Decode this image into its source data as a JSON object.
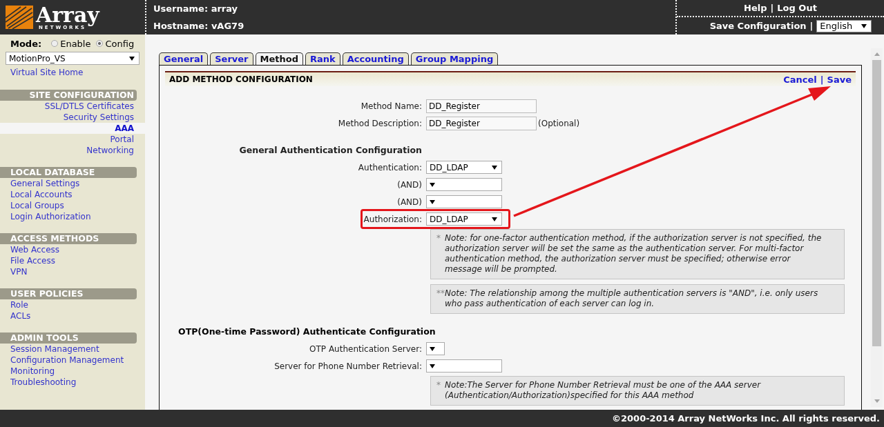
{
  "header": {
    "logo": {
      "name": "Array",
      "sub": "NETWORKS"
    },
    "username": "Username: array",
    "hostname": "Hostname: vAG79",
    "links": [
      "Help",
      "Log Out"
    ],
    "separator": "|",
    "save_config": "Save Configuration",
    "language": "English"
  },
  "sidebar": {
    "mode_label": "Mode:",
    "modes": [
      {
        "label": "Enable",
        "selected": false
      },
      {
        "label": "Config",
        "selected": true
      }
    ],
    "site": "MotionPro_VS",
    "home": "Virtual Site Home",
    "sections": [
      {
        "title": "SITE CONFIGURATION",
        "kind": "right",
        "items": [
          {
            "label": "SSL/DTLS Certificates",
            "selected": false
          },
          {
            "label": "Security Settings",
            "selected": false
          },
          {
            "label": "AAA",
            "selected": true
          },
          {
            "label": "Portal",
            "selected": false
          },
          {
            "label": "Networking",
            "selected": false
          }
        ]
      },
      {
        "title": "LOCAL DATABASE",
        "kind": "left",
        "items": [
          {
            "label": "General Settings",
            "selected": false
          },
          {
            "label": "Local Accounts",
            "selected": false
          },
          {
            "label": "Local Groups",
            "selected": false
          },
          {
            "label": "Login Authorization",
            "selected": false
          }
        ]
      },
      {
        "title": "ACCESS METHODS",
        "kind": "left",
        "items": [
          {
            "label": "Web Access",
            "selected": false
          },
          {
            "label": "File Access",
            "selected": false
          },
          {
            "label": "VPN",
            "selected": false
          }
        ]
      },
      {
        "title": "USER POLICIES",
        "kind": "left",
        "items": [
          {
            "label": "Role",
            "selected": false
          },
          {
            "label": "ACLs",
            "selected": false
          }
        ]
      },
      {
        "title": "ADMIN TOOLS",
        "kind": "left",
        "items": [
          {
            "label": "Session Management",
            "selected": false
          },
          {
            "label": "Configuration Management",
            "selected": false
          },
          {
            "label": "Monitoring",
            "selected": false
          },
          {
            "label": "Troubleshooting",
            "selected": false
          }
        ]
      }
    ]
  },
  "tabs": [
    {
      "label": "General",
      "selected": false
    },
    {
      "label": "Server",
      "selected": false
    },
    {
      "label": "Method",
      "selected": true
    },
    {
      "label": "Rank",
      "selected": false
    },
    {
      "label": "Accounting",
      "selected": false
    },
    {
      "label": "Group Mapping",
      "selected": false
    }
  ],
  "panel": {
    "title": "ADD METHOD CONFIGURATION",
    "actions": [
      "Cancel",
      "Save"
    ],
    "separator": "|"
  },
  "rows": [
    {
      "kind": "input",
      "label": "Method Name:",
      "value": "DD_Register"
    },
    {
      "kind": "input",
      "label": "Method Description:",
      "value": "DD_Register",
      "suffix": "(Optional)"
    },
    {
      "kind": "subheading",
      "text": "General Authentication Configuration"
    },
    {
      "kind": "select",
      "label": "Authentication:",
      "value": "DD_LDAP",
      "highlighted": false
    },
    {
      "kind": "select",
      "label": "(AND)",
      "highlighted": false
    },
    {
      "kind": "select",
      "label": "(AND)",
      "highlighted": false
    },
    {
      "kind": "select",
      "label": "Authorization:",
      "value": "DD_LDAP",
      "highlighted": true
    },
    {
      "kind": "note",
      "marker": "*",
      "text": "Note: for one-factor authentication method, if the authorization server is not specified, the authorization server will be set the same as the authentication server. For multi-factor authentication method, the authorization server must be specified; otherwise error message will be prompted."
    },
    {
      "kind": "note",
      "marker": "**",
      "text": "Note: The relationship among the multiple authentication servers is \"AND\", i.e. only users who pass authentication of each server can log in."
    },
    {
      "kind": "heading",
      "text": "OTP(One-time Password) Authenticate Configuration"
    },
    {
      "kind": "select",
      "label": "OTP Authentication Server:",
      "narrow": true,
      "highlighted": false
    },
    {
      "kind": "select",
      "label": "Server for Phone Number Retrieval:",
      "highlighted": false
    },
    {
      "kind": "note",
      "marker": "*",
      "text": "Note:The Server for Phone Number Retrieval must be one of the AAA server (Authentication/Authorization)specified for this AAA method"
    }
  ],
  "footer": "©2000-2014 Array NetWorks Inc. All rights reserved."
}
